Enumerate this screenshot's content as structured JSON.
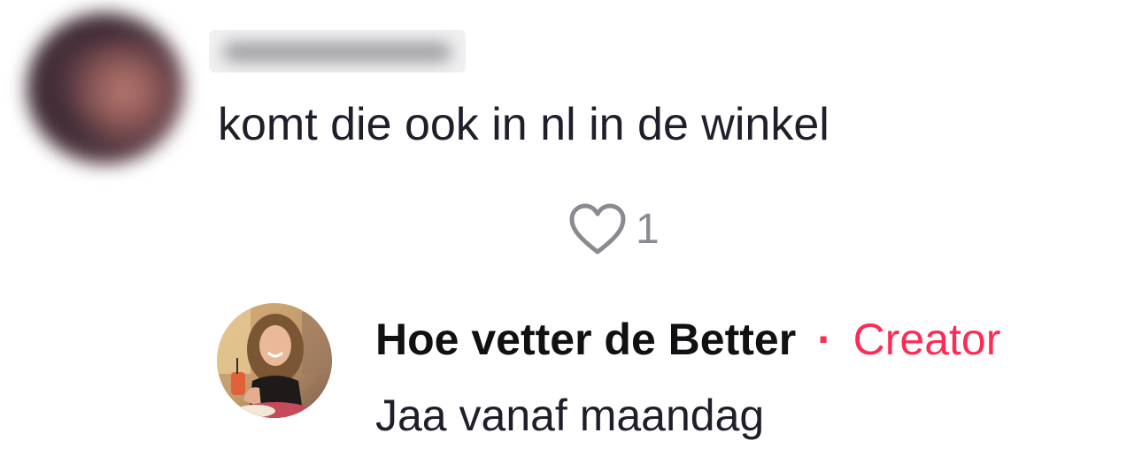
{
  "comment": {
    "avatar_icon": "user-avatar-blurred",
    "username": "",
    "text": "komt die ook in nl in de winkel",
    "like_icon": "heart-outline-icon",
    "like_count": "1"
  },
  "reply": {
    "avatar_icon": "creator-avatar-photo",
    "author": "Hoe vetter de Better",
    "separator": "·",
    "badge": "Creator",
    "text": "Jaa vanaf maandag"
  },
  "colors": {
    "accent": "#fe2c55",
    "text": "#1f1f2b",
    "muted": "#8a8b91"
  }
}
